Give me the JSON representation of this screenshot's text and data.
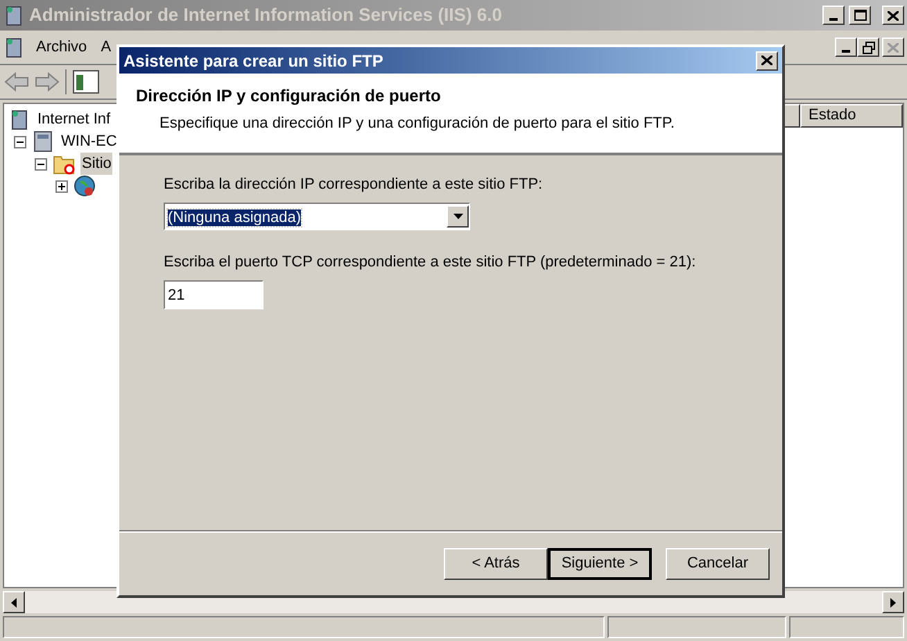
{
  "window": {
    "title": "Administrador de Internet Information Services (IIS) 6.0"
  },
  "menu": [
    {
      "label": "Archivo"
    },
    {
      "label": "A"
    }
  ],
  "tree": [
    {
      "label": "Internet Inf",
      "selected": false
    },
    {
      "label": "WIN-EC",
      "expanded": true,
      "selected": false,
      "children": [
        {
          "label": "Sitio",
          "expanded": true,
          "selected": true,
          "children": [
            {
              "expanded": false
            }
          ]
        }
      ]
    }
  ],
  "list": {
    "columns": [
      "Estado"
    ]
  },
  "dialog": {
    "title": "Asistente para crear un sitio FTP",
    "heading": "Dirección IP y configuración de puerto",
    "subtitle": "Especifique una dirección IP y una configuración de puerto para el sitio FTP.",
    "ip_label": "Escriba la dirección IP correspondiente a este sitio FTP:",
    "ip_value": "(Ninguna asignada)",
    "port_label": "Escriba el puerto TCP correspondiente a este sitio FTP (predeterminado = 21):",
    "port_value": "21",
    "buttons": [
      {
        "label": "< Atrás",
        "default": false
      },
      {
        "label": "Siguiente >",
        "default": true
      },
      {
        "label": "Cancelar",
        "default": false
      }
    ]
  }
}
